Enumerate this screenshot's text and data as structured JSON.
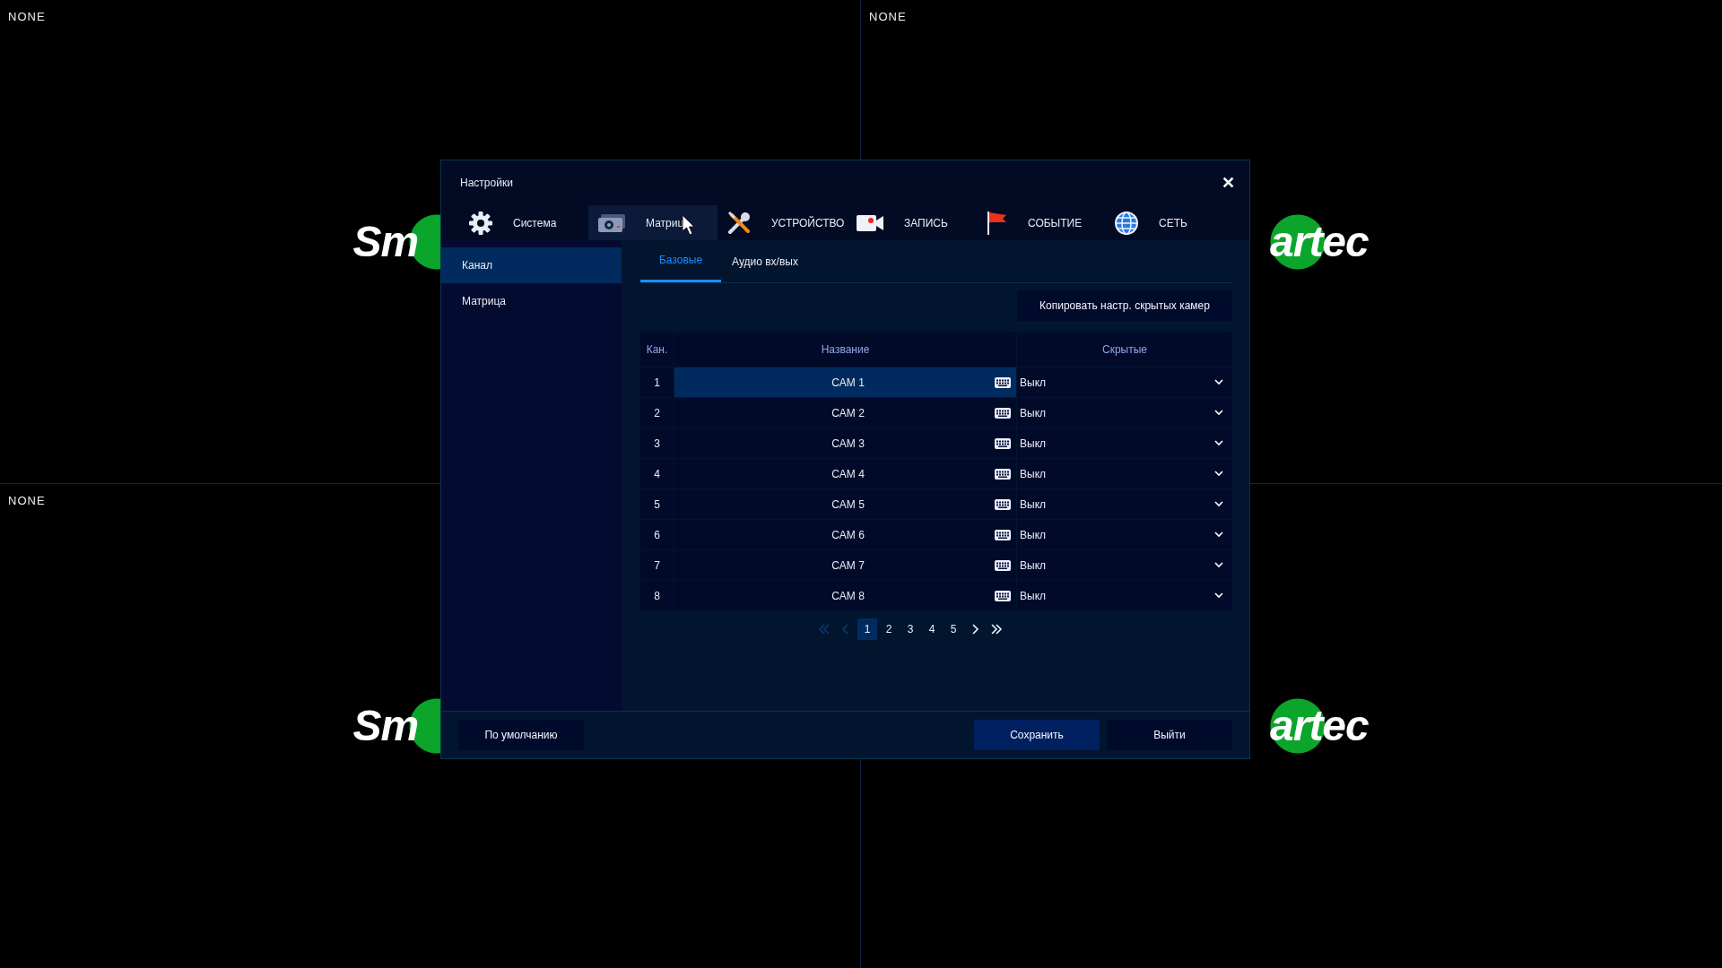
{
  "quadrants": [
    {
      "label": "NONE",
      "logo_text": "Sm"
    },
    {
      "label": "NONE",
      "logo_text": "artec"
    },
    {
      "label": "NONE",
      "logo_text": "Sm"
    },
    {
      "logo_text": "artec"
    }
  ],
  "window": {
    "title": "Настройки",
    "close": "✕"
  },
  "tabs": [
    {
      "label": "Система",
      "kind": "system",
      "selected": false
    },
    {
      "label": "Матриц",
      "kind": "matrix",
      "selected": true
    },
    {
      "label": "УСТРОЙСТВО",
      "kind": "device",
      "selected": false
    },
    {
      "label": "ЗАПИСЬ",
      "kind": "record",
      "selected": false
    },
    {
      "label": "СОБЫТИЕ",
      "kind": "event",
      "selected": false
    },
    {
      "label": "СЕТЬ",
      "kind": "network",
      "selected": false
    }
  ],
  "sidebar": {
    "items": [
      {
        "label": "Канал",
        "selected": true
      },
      {
        "label": "Матрица",
        "selected": false
      }
    ]
  },
  "subtabs": [
    {
      "label": "Базовые",
      "selected": true
    },
    {
      "label": "Аудио вх/вых",
      "selected": false
    }
  ],
  "copy_button": "Копировать настр. скрытых камер",
  "table": {
    "columns": [
      "Кан.",
      "Название",
      "Скрытые"
    ],
    "rows": [
      {
        "channel": "1",
        "name": "CAM 1",
        "hidden": "Выкл",
        "selected": true
      },
      {
        "channel": "2",
        "name": "CAM 2",
        "hidden": "Выкл",
        "selected": false
      },
      {
        "channel": "3",
        "name": "CAM 3",
        "hidden": "Выкл",
        "selected": false
      },
      {
        "channel": "4",
        "name": "CAM 4",
        "hidden": "Выкл",
        "selected": false
      },
      {
        "channel": "5",
        "name": "CAM 5",
        "hidden": "Выкл",
        "selected": false
      },
      {
        "channel": "6",
        "name": "CAM 6",
        "hidden": "Выкл",
        "selected": false
      },
      {
        "channel": "7",
        "name": "CAM 7",
        "hidden": "Выкл",
        "selected": false
      },
      {
        "channel": "8",
        "name": "CAM 8",
        "hidden": "Выкл",
        "selected": false
      }
    ]
  },
  "pagination": {
    "first_disabled": true,
    "prev_disabled": true,
    "next_disabled": false,
    "last_disabled": false,
    "pages": [
      {
        "label": "1",
        "selected": true
      },
      {
        "label": "2",
        "selected": false
      },
      {
        "label": "3",
        "selected": false
      },
      {
        "label": "4",
        "selected": false
      },
      {
        "label": "5",
        "selected": false
      }
    ]
  },
  "footer": {
    "default_button": "По умолчанию",
    "save_button": "Сохранить",
    "exit_button": "Выйти"
  }
}
